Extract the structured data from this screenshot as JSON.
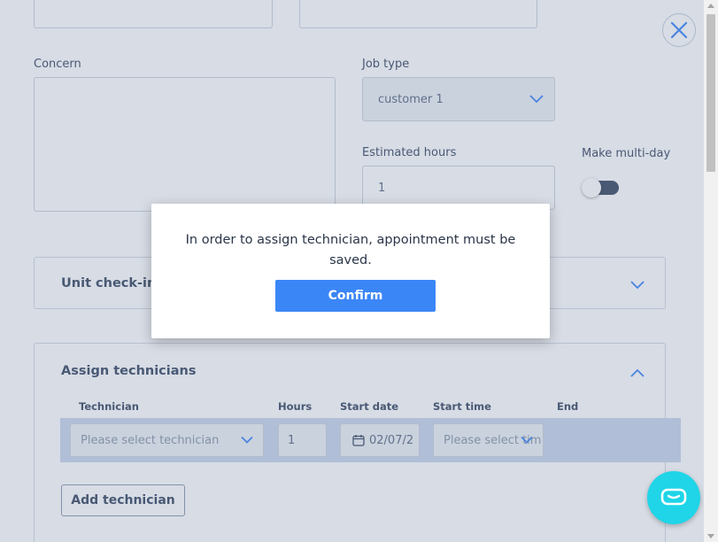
{
  "form": {
    "concern_label": "Concern",
    "job_type": {
      "label": "Job type",
      "value": "customer 1"
    },
    "estimated_hours": {
      "label": "Estimated hours",
      "value": "1"
    },
    "multi_day": {
      "label": "Make multi-day",
      "enabled": false
    }
  },
  "unit_checkin": {
    "title": "Unit check-in"
  },
  "assign_technicians": {
    "title": "Assign technicians",
    "columns": [
      "Technician",
      "Hours",
      "Start date",
      "Start time",
      "End"
    ],
    "row": {
      "technician_placeholder": "Please select technician",
      "hours": "1",
      "start_date": "02/07/2",
      "start_time_placeholder": "Please select tim"
    },
    "add_button": "Add technician"
  },
  "modal": {
    "message": "In order to assign technician, appointment must be saved.",
    "confirm_label": "Confirm"
  },
  "icons": {
    "close": "close-icon",
    "chevron": "chevron-down-icon",
    "calendar": "calendar-icon",
    "chat": "chat-icon"
  },
  "colors": {
    "primary": "#3b86f7",
    "text": "#3b4a63",
    "chat": "#1fd5e7",
    "row_highlight": "#c9d6ec"
  }
}
